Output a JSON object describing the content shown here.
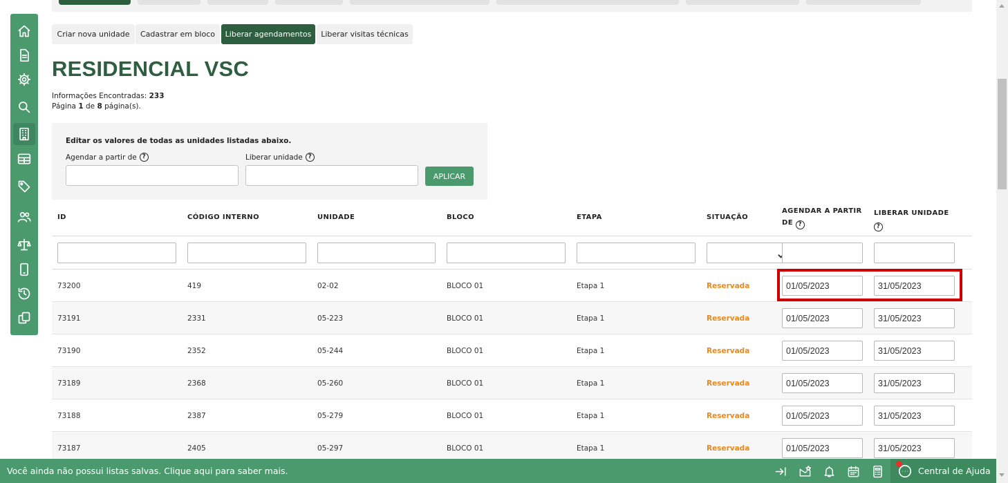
{
  "top_tabs": {
    "count": 8,
    "active_index": 0
  },
  "actions": {
    "create_unit": "Criar nova unidade",
    "bulk_register": "Cadastrar em bloco",
    "release_scheduling": "Liberar agendamentos",
    "release_technical_visits": "Liberar visitas técnicas"
  },
  "page": {
    "title": "RESIDENCIAL VSC",
    "found_label": "Informações Encontradas:",
    "found_count": "233",
    "page_prefix": "Página",
    "page_current": "1",
    "page_of": "de",
    "page_total": "8",
    "page_suffix": "página(s)."
  },
  "bulk_edit": {
    "title": "Editar os valores de todas as unidades listadas abaixo.",
    "schedule_from_label": "Agendar a partir de",
    "release_unit_label": "Liberar unidade",
    "schedule_from_value": "",
    "release_unit_value": "",
    "apply_label": "APLICAR"
  },
  "table": {
    "headers": {
      "id": "ID",
      "internal_code": "CÓDIGO INTERNO",
      "unit": "UNIDADE",
      "block": "BLOCO",
      "stage": "ETAPA",
      "status": "SITUAÇÃO",
      "schedule_from_line1": "AGENDAR A PARTIR",
      "schedule_from_line2": "DE",
      "release_unit": "LIBERAR UNIDADE"
    },
    "rows": [
      {
        "id": "73200",
        "code": "419",
        "unit": "02-02",
        "block": "BLOCO 01",
        "stage": "Etapa 1",
        "status": "Reservada",
        "schedule_from": "01/05/2023",
        "release_unit": "31/05/2023"
      },
      {
        "id": "73191",
        "code": "2331",
        "unit": "05-223",
        "block": "BLOCO 01",
        "stage": "Etapa 1",
        "status": "Reservada",
        "schedule_from": "01/05/2023",
        "release_unit": "31/05/2023"
      },
      {
        "id": "73190",
        "code": "2352",
        "unit": "05-244",
        "block": "BLOCO 01",
        "stage": "Etapa 1",
        "status": "Reservada",
        "schedule_from": "01/05/2023",
        "release_unit": "31/05/2023"
      },
      {
        "id": "73189",
        "code": "2368",
        "unit": "05-260",
        "block": "BLOCO 01",
        "stage": "Etapa 1",
        "status": "Reservada",
        "schedule_from": "01/05/2023",
        "release_unit": "31/05/2023"
      },
      {
        "id": "73188",
        "code": "2387",
        "unit": "05-279",
        "block": "BLOCO 01",
        "stage": "Etapa 1",
        "status": "Reservada",
        "schedule_from": "01/05/2023",
        "release_unit": "31/05/2023"
      },
      {
        "id": "73187",
        "code": "2405",
        "unit": "05-297",
        "block": "BLOCO 01",
        "stage": "Etapa 1",
        "status": "Reservada",
        "schedule_from": "01/05/2023",
        "release_unit": "31/05/2023"
      }
    ]
  },
  "bottom_bar": {
    "message": "Você ainda não possui listas salvas. Clique aqui para saber mais.",
    "help_center": "Central de Ajuda"
  },
  "colors": {
    "brand_dark": "#2d5e3f",
    "brand": "#4a9a6e",
    "status_reserved": "#e8891d",
    "highlight": "#cc0000"
  },
  "icons": {
    "sidebar": [
      "home-icon",
      "document-icon",
      "gear-icon",
      "search-icon",
      "building-icon",
      "table-icon",
      "tag-icon",
      "users-icon",
      "scale-icon",
      "mobile-icon",
      "history-icon",
      "copy-icon"
    ],
    "bottom": [
      "collapse-arrow-icon",
      "favorite-envelope-icon",
      "bell-icon",
      "calendar-icon",
      "calculator-icon",
      "chat-support-icon"
    ]
  }
}
